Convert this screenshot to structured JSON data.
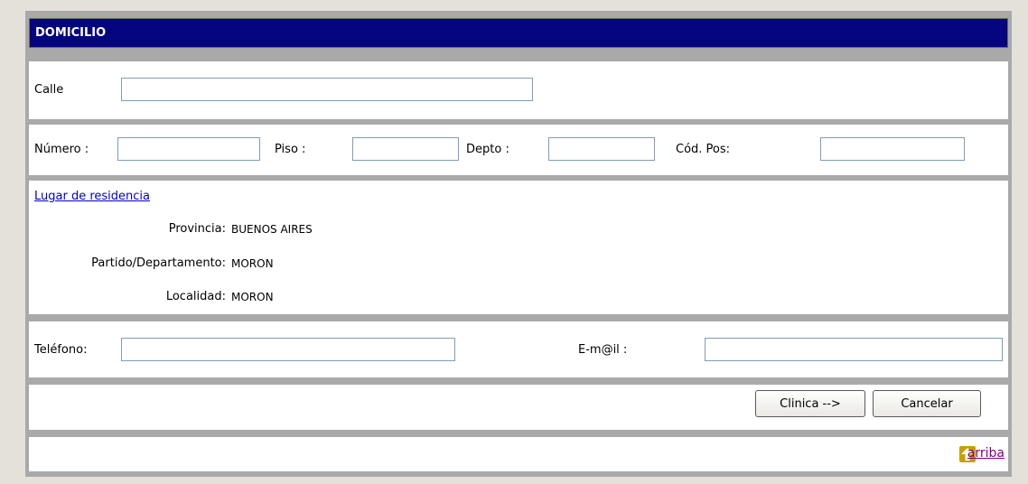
{
  "section": {
    "title": "DOMICILIO"
  },
  "calle": {
    "label": "Calle",
    "value": ""
  },
  "numero": {
    "label": "Número :",
    "value": ""
  },
  "piso": {
    "label": "Piso :",
    "value": ""
  },
  "depto": {
    "label": "Depto :",
    "value": ""
  },
  "codpos": {
    "label": "Cód. Pos:",
    "value": ""
  },
  "residencia": {
    "link_label": "Lugar de residencia",
    "provincia_label": "Provincia:",
    "provincia_value": "BUENOS AIRES",
    "partido_label": "Partido/Departamento:",
    "partido_value": "MORON",
    "localidad_label": "Localidad:",
    "localidad_value": "MORON"
  },
  "telefono": {
    "label": "Teléfono:",
    "value": ""
  },
  "email": {
    "label": "E-m@il :",
    "value": ""
  },
  "buttons": {
    "clinica": "Clinica -->",
    "cancelar": "Cancelar"
  },
  "footer": {
    "arriba_label": "arriba",
    "icon": "up-arrow-icon",
    "icon_color": "#c8a000"
  },
  "colors": {
    "header_bg": "#050580",
    "link": "#0000cc",
    "visited_link": "#800080"
  }
}
